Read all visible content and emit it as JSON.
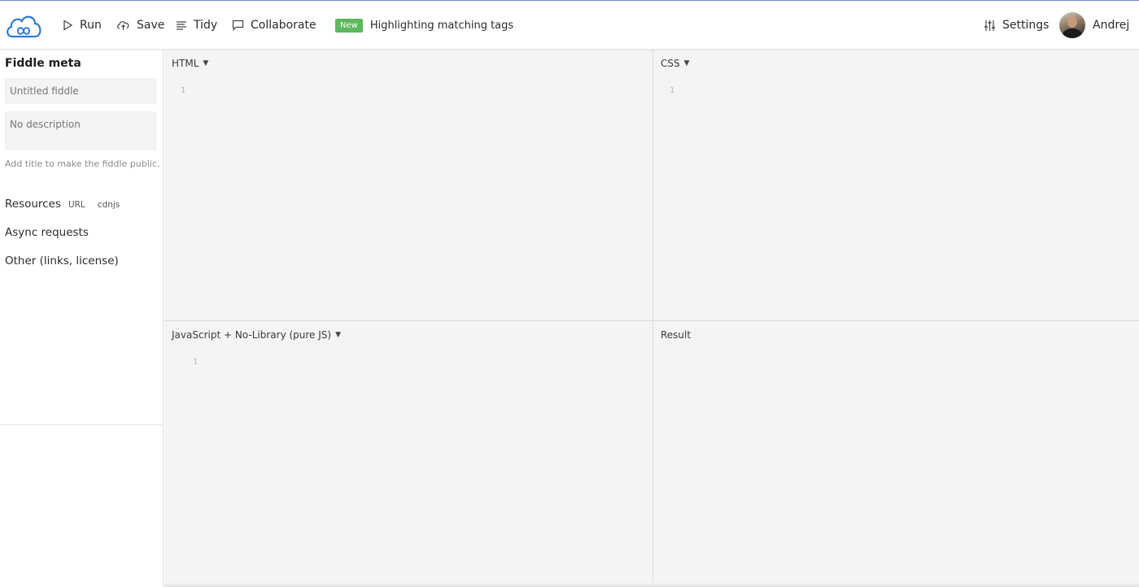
{
  "colors": {
    "accent": "#2b7bd6",
    "badge": "#5cb85c",
    "panel_bg": "#f3f4f6"
  },
  "toolbar": {
    "run_label": "Run",
    "save_label": "Save",
    "tidy_label": "Tidy",
    "collaborate_label": "Collaborate",
    "badge_label": "New",
    "announcement": "Highlighting matching tags",
    "settings_label": "Settings",
    "user_name": "Andrej"
  },
  "sidebar": {
    "title": "Fiddle meta",
    "title_placeholder": "Untitled fiddle",
    "description_placeholder": "No description",
    "hint": "Add title to make the fiddle public.",
    "resources_label": "Resources",
    "resources_links": [
      "URL",
      "cdnjs"
    ],
    "async_label": "Async requests",
    "other_label": "Other (links, license)"
  },
  "panels": {
    "html": {
      "label": "HTML",
      "line_number": "1"
    },
    "css": {
      "label": "CSS",
      "line_number": "1"
    },
    "js": {
      "label": "JavaScript + No-Library (pure JS)",
      "line_number": "1"
    },
    "result": {
      "label": "Result"
    }
  },
  "icons": [
    "logo-cloud-icon",
    "play-icon",
    "upload-cloud-icon",
    "tidy-lines-icon",
    "chat-icon",
    "sliders-icon",
    "caret-down-icon"
  ]
}
